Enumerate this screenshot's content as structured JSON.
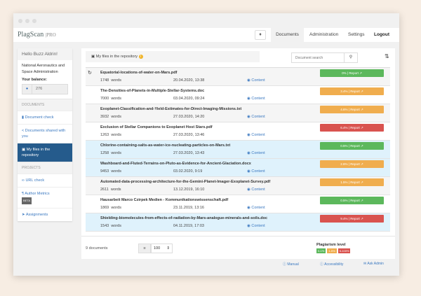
{
  "header": {
    "logo": "PlagScan",
    "logo_suffix": "PRO",
    "nav": [
      "Documents",
      "Administration",
      "Settings",
      "Logout"
    ]
  },
  "sidebar": {
    "hello": "Hello Buzz Aldrin!",
    "org": "National Aeronautics and Space Administration",
    "balance_label": "Your balance:",
    "balance": "276",
    "sec_documents": "DOCUMENTS",
    "sec_projects": "PROJECTS",
    "items": [
      {
        "label": "Document check",
        "icon": "file-icon"
      },
      {
        "label": "Documents shared with you",
        "icon": "share-icon"
      },
      {
        "label": "My files in the repository",
        "icon": "archive-icon",
        "active": true
      },
      {
        "label": "URL check",
        "icon": "link-icon"
      },
      {
        "label": "Author Metrics",
        "icon": "paragraph-icon",
        "badge": "BETA"
      },
      {
        "label": "Assignments",
        "icon": "send-icon"
      }
    ]
  },
  "main": {
    "breadcrumb": "My files in the repository",
    "search_placeholder": "Document search",
    "words_label": "words",
    "content_label": "Content",
    "report_label": "Report",
    "documents": [
      {
        "name": "Equatorial-locations-of-water-on-Mars.pdf",
        "words": "1748",
        "date": "20.04.2020, 13:38",
        "score": "0%",
        "level": "green",
        "bg": "gray"
      },
      {
        "name": "The-Densities-of-Planets-in-Multiple-Stellar-Systems.doc",
        "words": "7000",
        "date": "03.04.2020, 09:24",
        "score": "3.4%",
        "level": "orange",
        "bg": "white"
      },
      {
        "name": "Exoplanet-Classification-and-Yield-Estimates-for-Direct-Imaging-Missions.txt",
        "words": "3932",
        "date": "27.03.2020, 14:20",
        "score": "4.6%",
        "level": "orange",
        "bg": "gray"
      },
      {
        "name": "Exclusion of Stellar Companions to Exoplanet Host Stars.pdf",
        "words": "1263",
        "date": "27.03.2020, 13:46",
        "score": "6.4%",
        "level": "red",
        "bg": "white"
      },
      {
        "name": "Chlorine-containing-salts-as-water-ice-nucleating-particles-on-Mars.txt",
        "words": "1258",
        "date": "27.03.2020, 13:43",
        "score": "0.5%",
        "level": "green",
        "bg": "blue"
      },
      {
        "name": "Washboard-and-Fluted-Terrains-on-Pluto-as-Evidence-for-Ancient-Glaciation.docx",
        "words": "9453",
        "date": "03.02.2020, 9:19",
        "score": "2.6%",
        "level": "orange",
        "bg": "blue"
      },
      {
        "name": "Automated-data-processing-architecture-for-the-Gemini-Planet-Imager-Exoplanet-Survey.pdf",
        "words": "2611",
        "date": "13.12.2019, 16:10",
        "score": "1.5%",
        "level": "orange",
        "bg": "gray"
      },
      {
        "name": "Hausarbeit Marco Czirpek Medien - Kommunikationswissenschaft.pdf",
        "words": "1869",
        "date": "23.11.2019, 13:16",
        "score": "0.5%",
        "level": "green",
        "bg": "white"
      },
      {
        "name": "Shielding-biomolecules-from-effects-of-radiation-by-Mars-analogue-minerals-and-soils.doc",
        "words": "1543",
        "date": "04.11.2019, 17:03",
        "score": "9.4%",
        "level": "red",
        "bg": "blue"
      }
    ],
    "count": "9 documents",
    "per_page": "100",
    "legend_title": "Plagiarism level",
    "legend": [
      "0-1%",
      "1-5%",
      "5-100%"
    ]
  },
  "footer": {
    "links": [
      "Manual",
      "Accessibility",
      "Ask Admin"
    ]
  },
  "colors": {
    "green": "#5cb85c",
    "orange": "#f0ad4e",
    "red": "#d9534f",
    "gray": "#f5f5f5",
    "white": "#ffffff",
    "blue": "#dff2fc",
    "active": "#255b8c"
  }
}
